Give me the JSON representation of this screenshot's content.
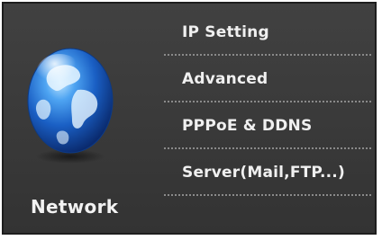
{
  "section": {
    "title": "Network",
    "icon": "globe-icon"
  },
  "menu": {
    "items": [
      {
        "label": "IP Setting"
      },
      {
        "label": "Advanced"
      },
      {
        "label": "PPPoE & DDNS"
      },
      {
        "label": "Server(Mail,FTP...)"
      }
    ]
  },
  "colors": {
    "panel_background": "#3a3a3a",
    "text": "#f0f0f0",
    "separator": "#8a8a8a",
    "globe_blue": "#1e6fd9"
  }
}
